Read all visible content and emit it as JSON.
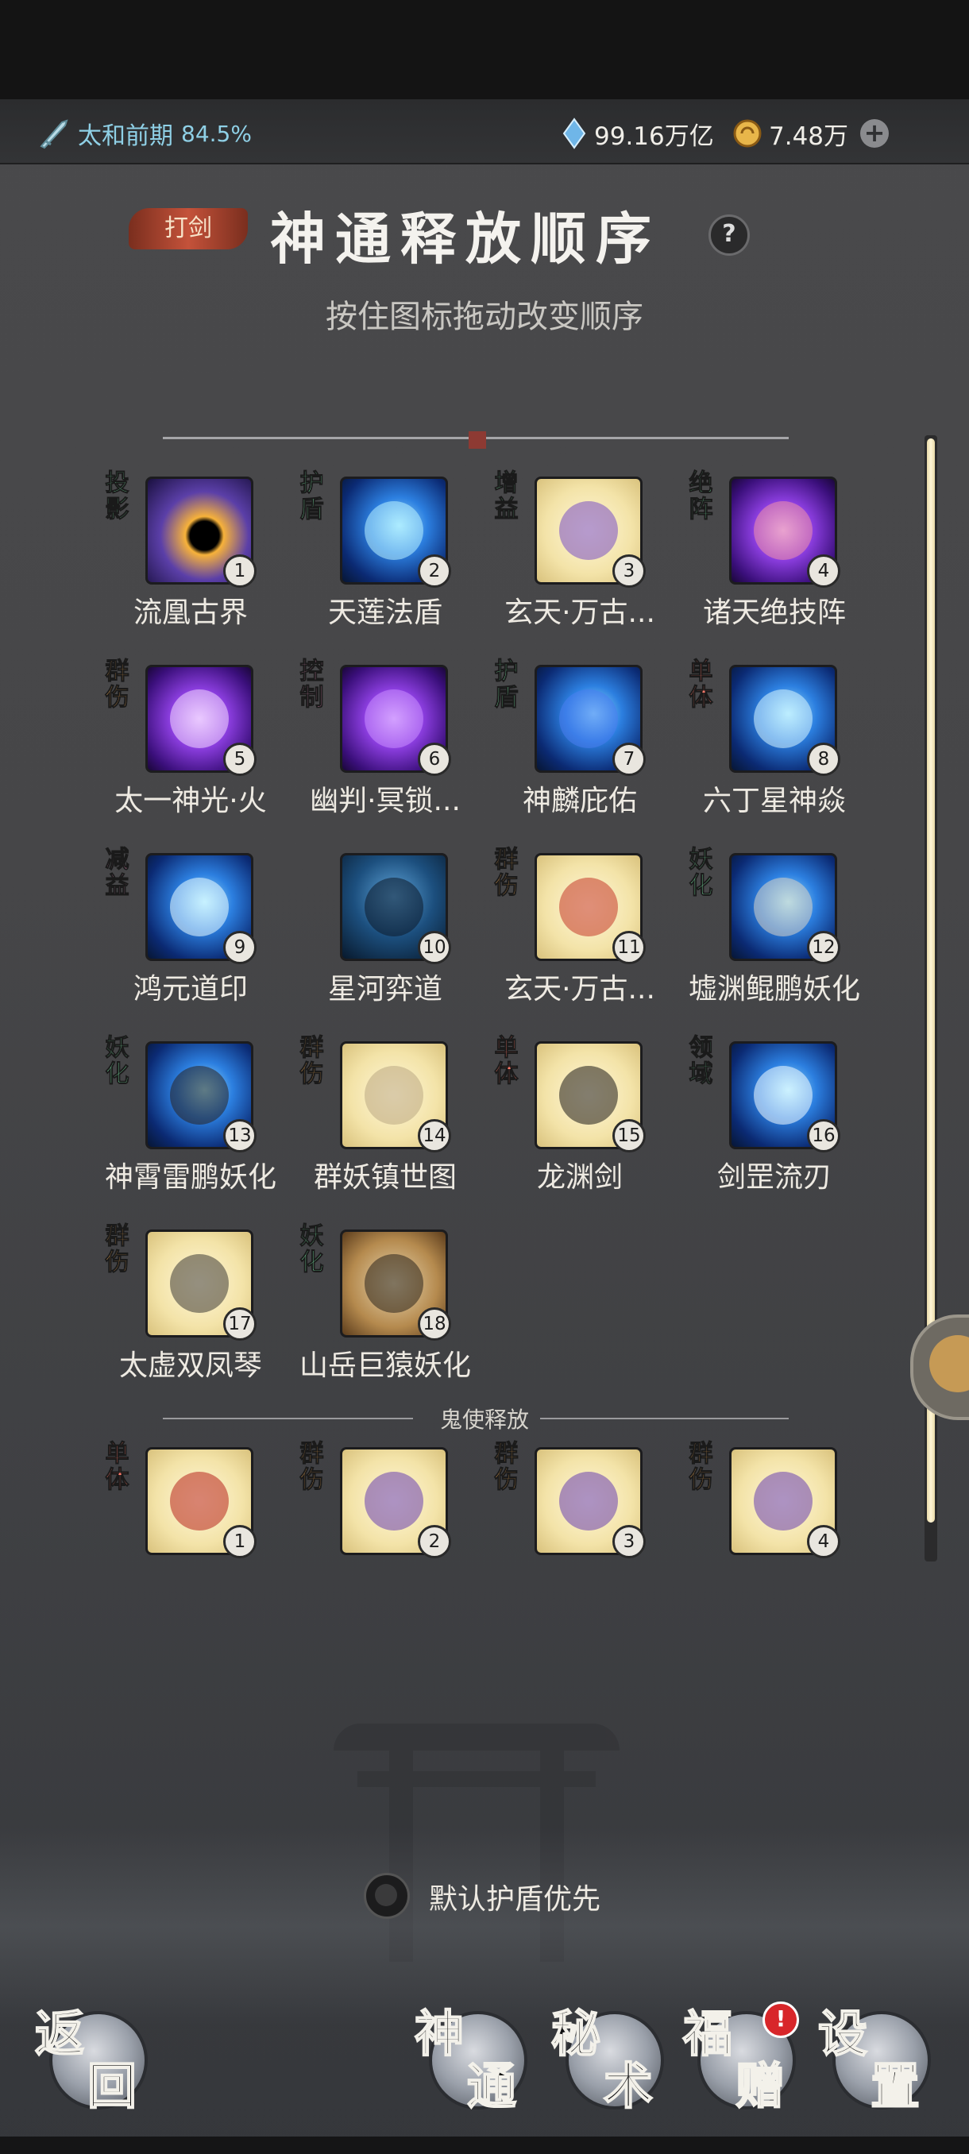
{
  "status": {
    "realm_name": "太和前期",
    "realm_progress": "84.5%",
    "spirit_stones": "99.16万亿",
    "gold": "7.48万",
    "add_label": "+"
  },
  "header": {
    "tag": "打剑",
    "title": "神通释放顺序",
    "help": "?",
    "subtitle": "按住图标拖动改变顺序"
  },
  "skills": [
    {
      "type": "投影",
      "name": "流凰古界",
      "order": "1"
    },
    {
      "type": "护盾",
      "name": "天莲法盾",
      "order": "2"
    },
    {
      "type": "增益",
      "name": "玄天·万古...",
      "order": "3"
    },
    {
      "type": "绝阵",
      "name": "诸天绝技阵",
      "order": "4"
    },
    {
      "type": "群伤",
      "name": "太一神光·火",
      "order": "5"
    },
    {
      "type": "控制",
      "name": "幽判·冥锁...",
      "order": "6"
    },
    {
      "type": "护盾",
      "name": "神麟庇佑",
      "order": "7"
    },
    {
      "type": "单体",
      "name": "六丁星神焱",
      "order": "8"
    },
    {
      "type": "减益",
      "name": "鸿元道印",
      "order": "9"
    },
    {
      "type": "",
      "name": "星河弈道",
      "order": "10"
    },
    {
      "type": "群伤",
      "name": "玄天·万古...",
      "order": "11"
    },
    {
      "type": "妖化",
      "name": "墟渊鲲鹏妖化",
      "order": "12"
    },
    {
      "type": "妖化",
      "name": "神霄雷鹏妖化",
      "order": "13"
    },
    {
      "type": "群伤",
      "name": "群妖镇世图",
      "order": "14"
    },
    {
      "type": "单体",
      "name": "龙渊剑",
      "order": "15"
    },
    {
      "type": "领域",
      "name": "剑罡流刃",
      "order": "16"
    },
    {
      "type": "群伤",
      "name": "太虚双凤琴",
      "order": "17"
    },
    {
      "type": "妖化",
      "name": "山岳巨猿妖化",
      "order": "18"
    }
  ],
  "ghost": {
    "label": "鬼使释放",
    "items": [
      {
        "type": "单体",
        "order": "1"
      },
      {
        "type": "群伤",
        "order": "2"
      },
      {
        "type": "群伤",
        "order": "3"
      },
      {
        "type": "群伤",
        "order": "4"
      }
    ]
  },
  "options": {
    "default_shield_first": "默认护盾优先",
    "default_shield_first_on": false
  },
  "nav": {
    "back": [
      "返",
      "回"
    ],
    "shentong": [
      "神",
      "通"
    ],
    "mishu": [
      "秘",
      "术"
    ],
    "fuzeng": [
      "福",
      "赠"
    ],
    "settings": [
      "设",
      "置"
    ],
    "fuzeng_badge": "!"
  }
}
